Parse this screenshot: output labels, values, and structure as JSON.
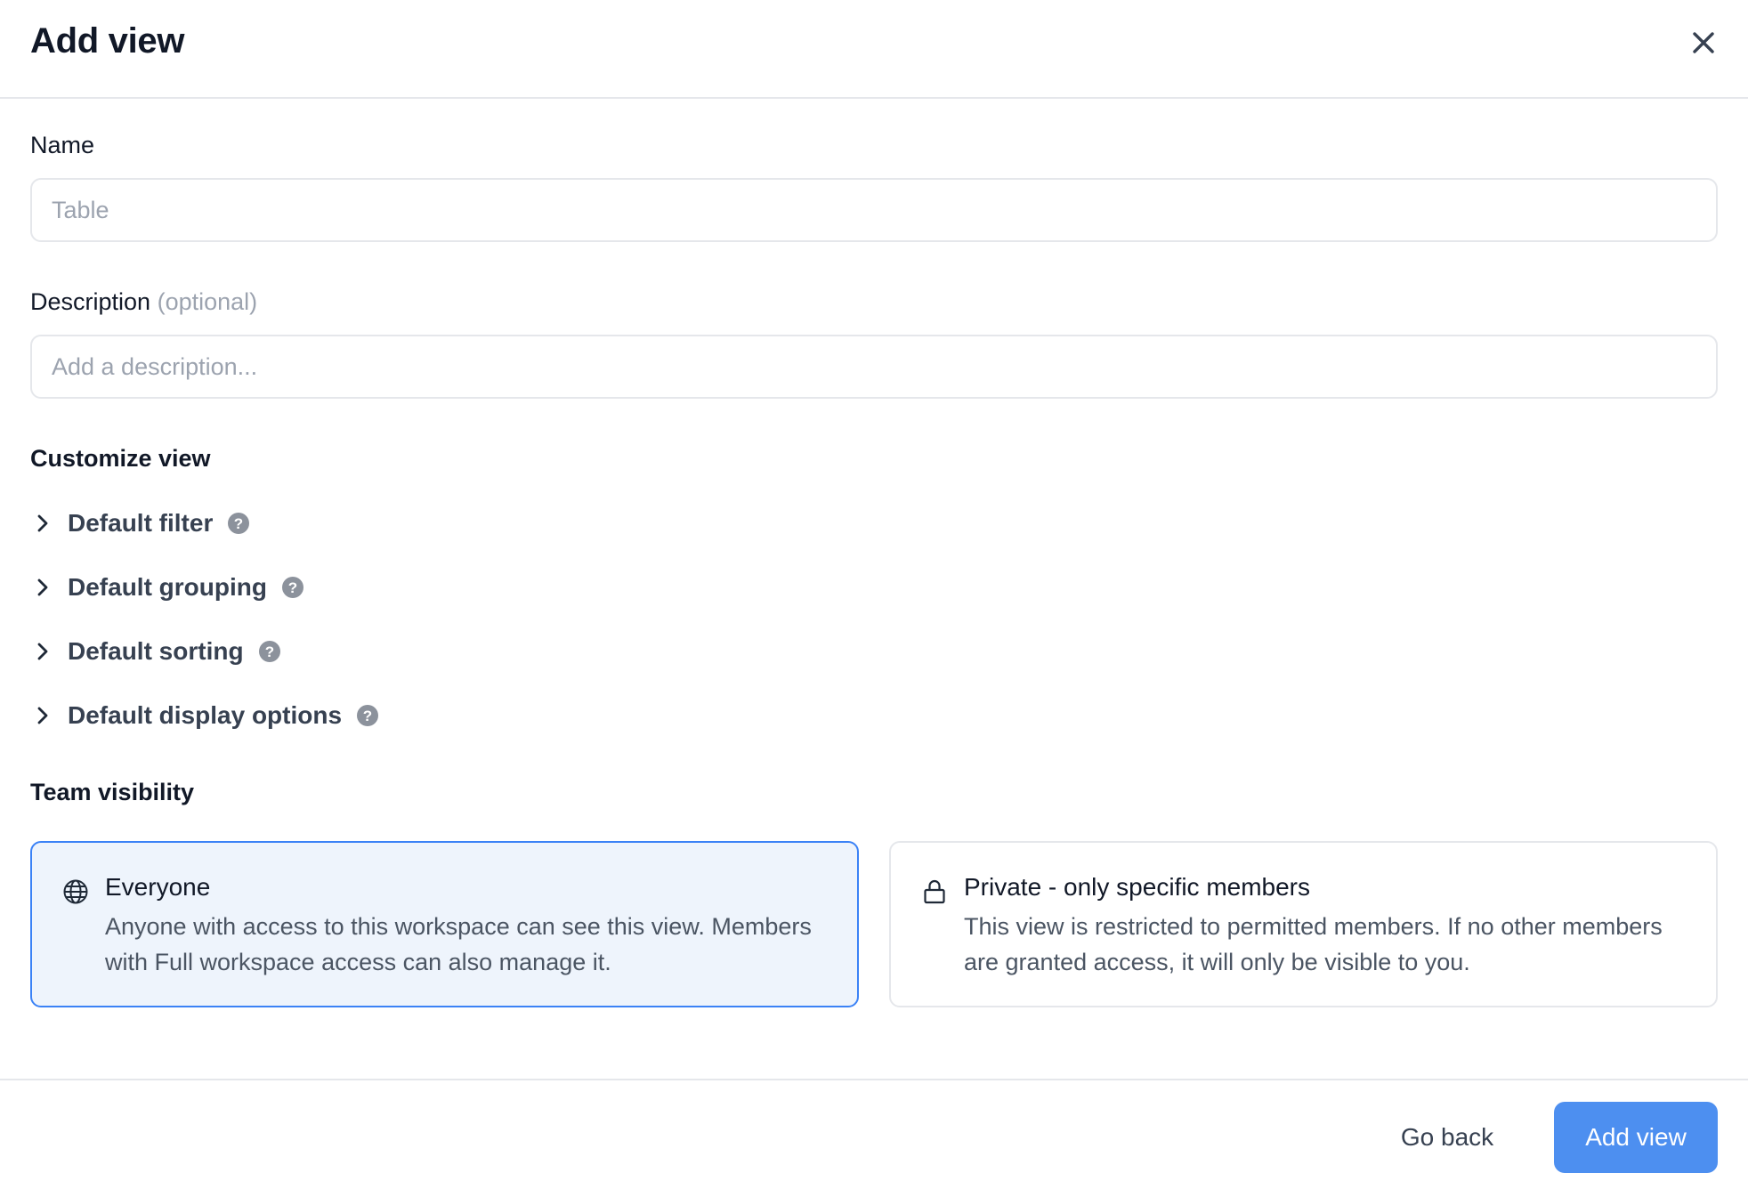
{
  "dialog": {
    "title": "Add view",
    "close_icon": "close-icon"
  },
  "name_field": {
    "label": "Name",
    "value": "",
    "placeholder": "Table"
  },
  "description_field": {
    "label": "Description",
    "optional_hint": "(optional)",
    "value": "",
    "placeholder": "Add a description..."
  },
  "customize": {
    "title": "Customize view",
    "options": [
      {
        "label": "Default filter",
        "icon": "chevron-right-icon",
        "help_icon": "help-icon"
      },
      {
        "label": "Default grouping",
        "icon": "chevron-right-icon",
        "help_icon": "help-icon"
      },
      {
        "label": "Default sorting",
        "icon": "chevron-right-icon",
        "help_icon": "help-icon"
      },
      {
        "label": "Default display options",
        "icon": "chevron-right-icon",
        "help_icon": "help-icon"
      }
    ]
  },
  "visibility": {
    "title": "Team visibility",
    "options": [
      {
        "title": "Everyone",
        "description": "Anyone with access to this workspace can see this view. Members with Full workspace access can also manage it.",
        "icon": "globe-icon",
        "selected": true
      },
      {
        "title": "Private - only specific members",
        "description": "This view is restricted to permitted members. If no other members are granted access, it will only be visible to you.",
        "icon": "lock-icon",
        "selected": false
      }
    ]
  },
  "footer": {
    "back_label": "Go back",
    "submit_label": "Add view"
  },
  "colors": {
    "primary": "#4d8ff0",
    "selected_border": "#3b82f6",
    "selected_bg": "#eef4fc"
  }
}
